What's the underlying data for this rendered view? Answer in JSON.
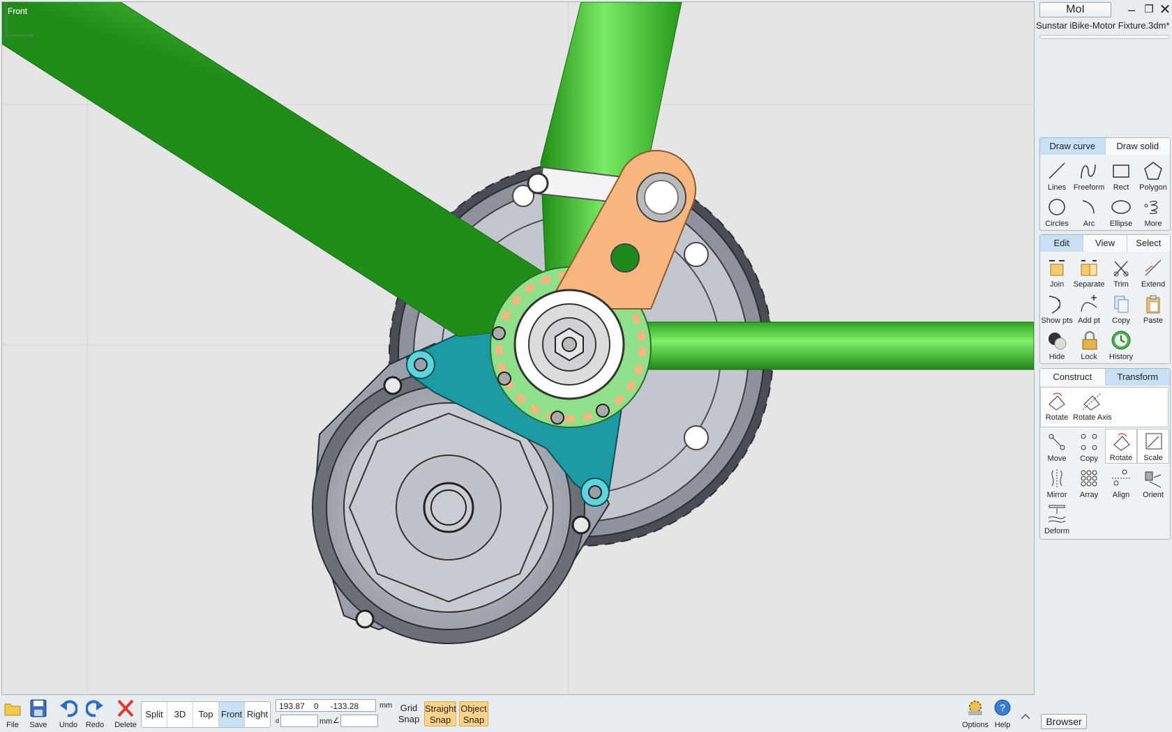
{
  "viewport": {
    "label": "Front",
    "axis_z": "z",
    "axis_x": "x"
  },
  "window": {
    "app_button": "MoI",
    "file_title": "Sunstar iBike-Motor Fixture.3dm*"
  },
  "draw_panel": {
    "tabs": [
      "Draw curve",
      "Draw solid"
    ],
    "tools": [
      {
        "label": "Lines",
        "icon": "lines-icon"
      },
      {
        "label": "Freeform",
        "icon": "freeform-icon"
      },
      {
        "label": "Rect",
        "icon": "rect-icon"
      },
      {
        "label": "Polygon",
        "icon": "polygon-icon"
      },
      {
        "label": "Circles",
        "icon": "circle-icon"
      },
      {
        "label": "Arc",
        "icon": "arc-icon"
      },
      {
        "label": "Ellipse",
        "icon": "ellipse-icon"
      },
      {
        "label": "More",
        "icon": "more-icon"
      }
    ]
  },
  "edit_panel": {
    "tabs": [
      "Edit",
      "View",
      "Select"
    ],
    "tools": [
      {
        "label": "Join",
        "icon": "join-icon"
      },
      {
        "label": "Separate",
        "icon": "separate-icon"
      },
      {
        "label": "Trim",
        "icon": "trim-icon"
      },
      {
        "label": "Extend",
        "icon": "extend-icon"
      },
      {
        "label": "Show pts",
        "icon": "show-points-icon"
      },
      {
        "label": "Add pt",
        "icon": "add-point-icon"
      },
      {
        "label": "Copy",
        "icon": "copy-icon"
      },
      {
        "label": "Paste",
        "icon": "paste-icon"
      },
      {
        "label": "Hide",
        "icon": "hide-icon"
      },
      {
        "label": "Lock",
        "icon": "lock-icon"
      },
      {
        "label": "History",
        "icon": "history-icon"
      }
    ]
  },
  "transform_panel": {
    "tabs": [
      "Construct",
      "Transform"
    ],
    "sub_tools": [
      {
        "label": "Rotate",
        "icon": "rotate-icon"
      },
      {
        "label": "Rotate Axis",
        "icon": "rotate-axis-icon"
      }
    ],
    "tools": [
      {
        "label": "Move",
        "icon": "move-icon"
      },
      {
        "label": "Copy",
        "icon": "copy-objects-icon"
      },
      {
        "label": "Rotate",
        "icon": "rotate-icon"
      },
      {
        "label": "Scale",
        "icon": "scale-icon"
      },
      {
        "label": "Mirror",
        "icon": "mirror-icon"
      },
      {
        "label": "Array",
        "icon": "array-icon"
      },
      {
        "label": "Align",
        "icon": "align-icon"
      },
      {
        "label": "Orient",
        "icon": "orient-icon"
      },
      {
        "label": "Deform",
        "icon": "deform-icon"
      }
    ]
  },
  "bottom": {
    "file": "File",
    "save": "Save",
    "undo": "Undo",
    "redo": "Redo",
    "delete": "Delete",
    "views": [
      "Split",
      "3D",
      "Top",
      "Front",
      "Right"
    ],
    "coords": "193.87    0     -133.28",
    "unit": "mm",
    "d_label": "d",
    "angle_label": "∠",
    "grid_snap": [
      "Grid",
      "Snap"
    ],
    "straight_snap": [
      "Straight",
      "Snap"
    ],
    "object_snap": [
      "Object",
      "Snap"
    ],
    "options": "Options",
    "help": "Help",
    "browser": "Browser"
  },
  "colors": {
    "frame_green": "#3fc02a",
    "plate_orange": "#f7b67d",
    "bracket_teal": "#1f9aa3",
    "chainring_green": "#8fe08a",
    "motor_gray": "#b9bcc4",
    "active_tab": "#c8e0f5",
    "snap_on": "#fdd38a"
  }
}
